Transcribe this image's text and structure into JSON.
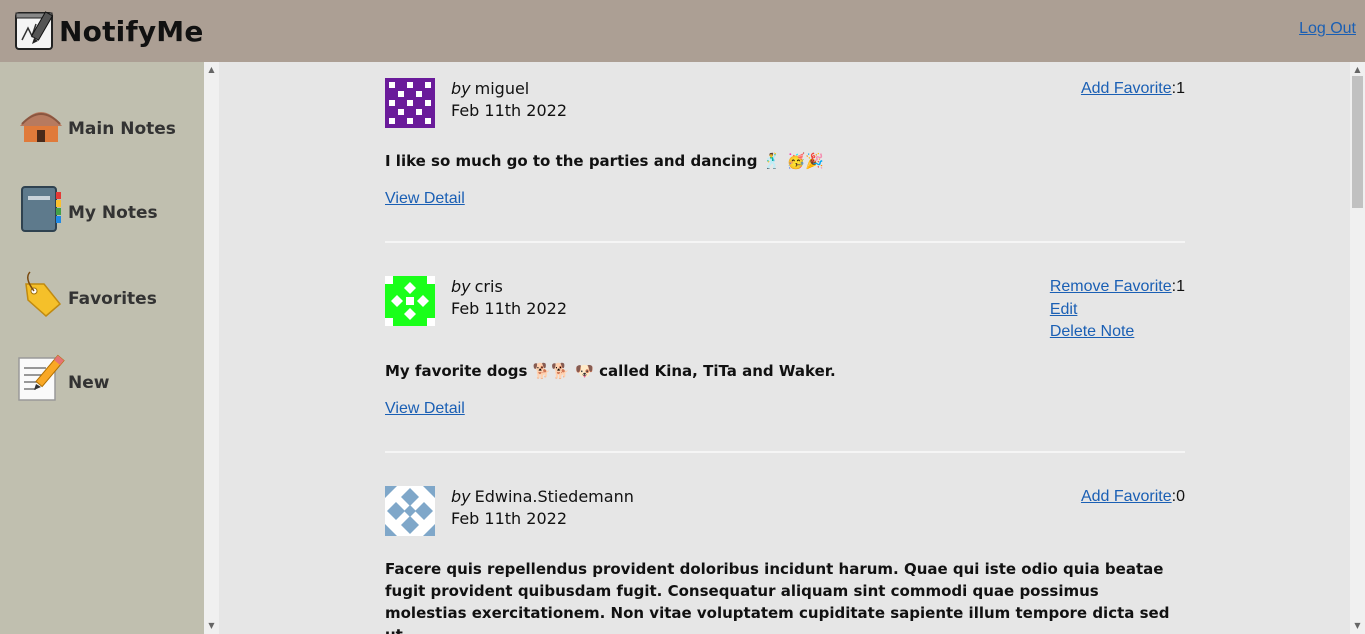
{
  "app": {
    "name": "NotifyMe",
    "logout_label": "Log Out",
    "logo_icon": "notepad-pen-icon"
  },
  "sidebar": {
    "items": [
      {
        "label": "Main Notes",
        "icon": "hut-icon"
      },
      {
        "label": "My Notes",
        "icon": "notebook-icon"
      },
      {
        "label": "Favorites",
        "icon": "tag-icon"
      },
      {
        "label": "New",
        "icon": "memo-pencil-icon"
      }
    ]
  },
  "notes": [
    {
      "by_label": "by",
      "author": "miguel",
      "date": "Feb 11th 2022",
      "favorite_action": "Add Favorite",
      "favorite_count": ":1",
      "body": "I like so much go to the parties and dancing 🕺 🥳🎉",
      "view_label": "View Detail",
      "avatar_color": "#6a1b9a"
    },
    {
      "by_label": "by",
      "author": "cris",
      "date": "Feb 11th 2022",
      "favorite_action": "Remove Favorite",
      "favorite_count": ":1",
      "edit_label": "Edit",
      "delete_label": "Delete Note",
      "body": "My favorite dogs 🐕🐕 🐶 called Kina, TiTa and Waker.",
      "view_label": "View Detail",
      "avatar_color": "#1aff1a"
    },
    {
      "by_label": "by",
      "author": "Edwina.Stiedemann",
      "date": "Feb 11th 2022",
      "favorite_action": "Add Favorite",
      "favorite_count": ":0",
      "body": "Facere quis repellendus provident doloribus incidunt harum. Quae qui iste odio quia beatae fugit provident quibusdam fugit. Consequatur aliquam sint commodi quae possimus molestias exercitationem. Non vitae voluptatem cupiditate sapiente illum tempore dicta sed ut.",
      "avatar_color": "#7fa7c9"
    }
  ],
  "colors": {
    "header_bg": "#ac9f94",
    "sidebar_bg": "#c0bfaf",
    "content_bg": "#e6e6e6",
    "link": "#1a5fb4"
  }
}
